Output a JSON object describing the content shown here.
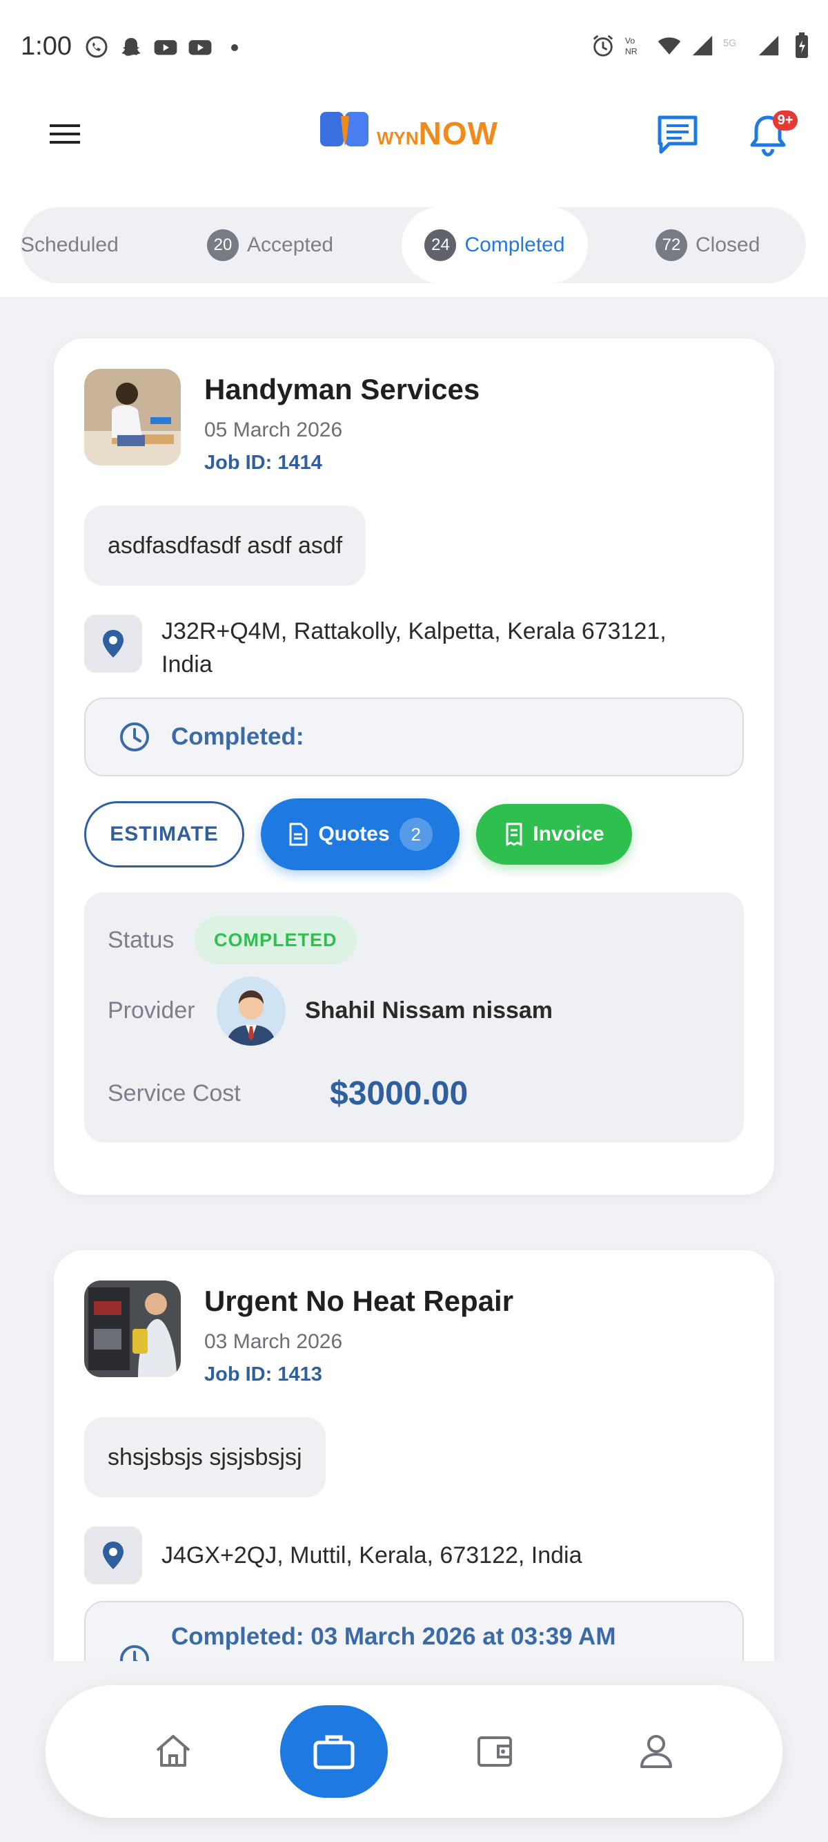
{
  "status_bar": {
    "time": "1:00",
    "left_icons": [
      "whatsapp-icon",
      "snapchat-icon",
      "youtube-icon",
      "youtube-icon",
      "dot-icon"
    ],
    "right_icons": [
      "alarm-icon",
      "volte-icon",
      "wifi-icon",
      "signal-icon",
      "5g-icon",
      "signal-icon",
      "battery-icon"
    ]
  },
  "header": {
    "logo_wyn": "WYN",
    "logo_now": "NOW",
    "notification_badge": "9+"
  },
  "tabs": [
    {
      "label": "Scheduled",
      "count": ""
    },
    {
      "label": "Accepted",
      "count": "20"
    },
    {
      "label": "Completed",
      "count": "24",
      "active": true
    },
    {
      "label": "Closed",
      "count": "72"
    }
  ],
  "jobs": [
    {
      "title": "Handyman Services",
      "date": "05 March 2026",
      "job_id": "Job ID: 1414",
      "description": "asdfasdfasdf asdf asdf",
      "location_line1": "J32R+Q4M, Rattakolly, Kalpetta, Kerala 673121,",
      "location_line2": "India",
      "completed": "Completed:",
      "estimate_label": "ESTIMATE",
      "quotes_label": "Quotes",
      "quotes_count": "2",
      "invoice_label": "Invoice",
      "status_label": "Status",
      "status_value": "COMPLETED",
      "provider_label": "Provider",
      "provider_name": "Shahil Nissam nissam",
      "cost_label": "Service Cost",
      "cost_value": "$3000.00"
    },
    {
      "title": "Urgent No Heat Repair",
      "date": "03 March 2026",
      "job_id": "Job ID: 1413",
      "description": "shsjsbsjs sjsjsbsjsj",
      "location_line1": "J4GX+2QJ, Muttil, Kerala, 673122, India",
      "completed": "Completed: 03 March 2026 at 03:39 AM"
    }
  ],
  "bottom_nav": [
    "home-icon",
    "briefcase-icon",
    "wallet-icon",
    "profile-icon"
  ],
  "colors": {
    "primary": "#1e7ae0",
    "accent_blue": "#2f5f9e",
    "success": "#2fbf4f",
    "brand_orange": "#f08a1a"
  }
}
